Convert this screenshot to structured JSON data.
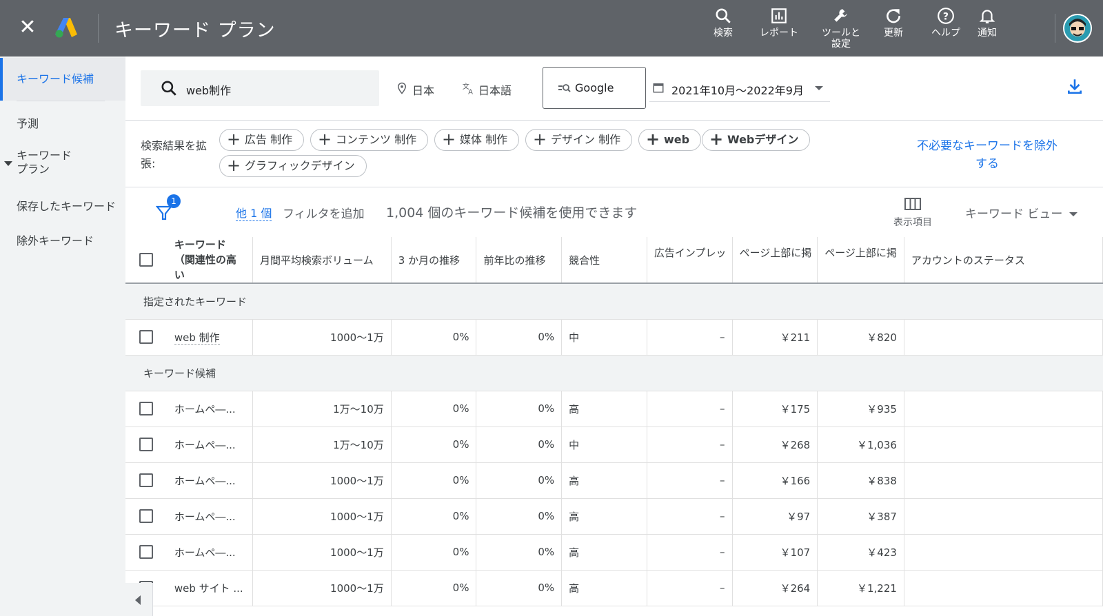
{
  "topbar": {
    "title": "キーワード プラン",
    "tools": [
      {
        "icon": "search-icon",
        "label": "検索"
      },
      {
        "icon": "report-icon",
        "label": "レポート"
      },
      {
        "icon": "wrench-icon",
        "label": "ツールと\n設定"
      },
      {
        "icon": "refresh-icon",
        "label": "更新"
      },
      {
        "icon": "help-icon",
        "label": "ヘルプ"
      },
      {
        "icon": "bell-icon",
        "label": "通知"
      }
    ]
  },
  "sidebar": {
    "items": [
      {
        "label": "キーワード候補"
      },
      {
        "label": "予測"
      },
      {
        "label": "キーワード\nプラン"
      },
      {
        "label": "保存したキーワード"
      },
      {
        "label": "除外キーワード"
      }
    ]
  },
  "search": {
    "query": "web制作",
    "location": "日本",
    "language": "日本語",
    "network": "Google",
    "date_range": "2021年10月〜2022年9月"
  },
  "expand": {
    "label": "検索結果を拡張:",
    "chips": [
      "広告 制作",
      "コンテンツ 制作",
      "媒体 制作",
      "デザイン 制作",
      "web",
      "Webデザイン",
      "グラフィックデザイン"
    ],
    "exclude_link": "不必要なキーワードを除外する"
  },
  "filterbar": {
    "badge": "1",
    "other": "他 1 個",
    "add_filter": "フィルタを追加",
    "count_text": "1,004 個のキーワード候補を使用できます",
    "columns_label": "表示項目",
    "view_label": "キーワード ビュー"
  },
  "table": {
    "headers": [
      "キーワード\n（関連性の高い",
      "月間平均検索ボリューム",
      "3 か月の推移",
      "前年比の推移",
      "競合性",
      "広告インプレッ",
      "ページ上部に掲",
      "ページ上部に掲",
      "アカウントのステータス"
    ],
    "group1": "指定されたキーワード",
    "group2": "キーワード候補",
    "specified": [
      {
        "kw": "web 制作",
        "vol": "1000〜1万",
        "m3": "0%",
        "yoy": "0%",
        "comp": "中",
        "imp": "–",
        "low": "￥211",
        "high": "￥820",
        "status": ""
      }
    ],
    "ideas": [
      {
        "kw": "ホームペ―...",
        "vol": "1万〜10万",
        "m3": "0%",
        "yoy": "0%",
        "comp": "高",
        "imp": "–",
        "low": "￥175",
        "high": "￥935",
        "status": ""
      },
      {
        "kw": "ホームペ―...",
        "vol": "1万〜10万",
        "m3": "0%",
        "yoy": "0%",
        "comp": "中",
        "imp": "–",
        "low": "￥268",
        "high": "￥1,036",
        "status": ""
      },
      {
        "kw": "ホームペ―...",
        "vol": "1000〜1万",
        "m3": "0%",
        "yoy": "0%",
        "comp": "高",
        "imp": "–",
        "low": "￥166",
        "high": "￥838",
        "status": ""
      },
      {
        "kw": "ホームペ―...",
        "vol": "1000〜1万",
        "m3": "0%",
        "yoy": "0%",
        "comp": "高",
        "imp": "–",
        "low": "￥97",
        "high": "￥387",
        "status": ""
      },
      {
        "kw": "ホームペ―...",
        "vol": "1000〜1万",
        "m3": "0%",
        "yoy": "0%",
        "comp": "高",
        "imp": "–",
        "low": "￥107",
        "high": "￥423",
        "status": ""
      },
      {
        "kw": "web サイト ...",
        "vol": "1000〜1万",
        "m3": "0%",
        "yoy": "0%",
        "comp": "高",
        "imp": "–",
        "low": "￥264",
        "high": "￥1,221",
        "status": ""
      }
    ]
  },
  "colors": {
    "topbar": "#5f6368",
    "accent": "#1a73e8",
    "sidebar_bg": "#f1f3f4"
  }
}
